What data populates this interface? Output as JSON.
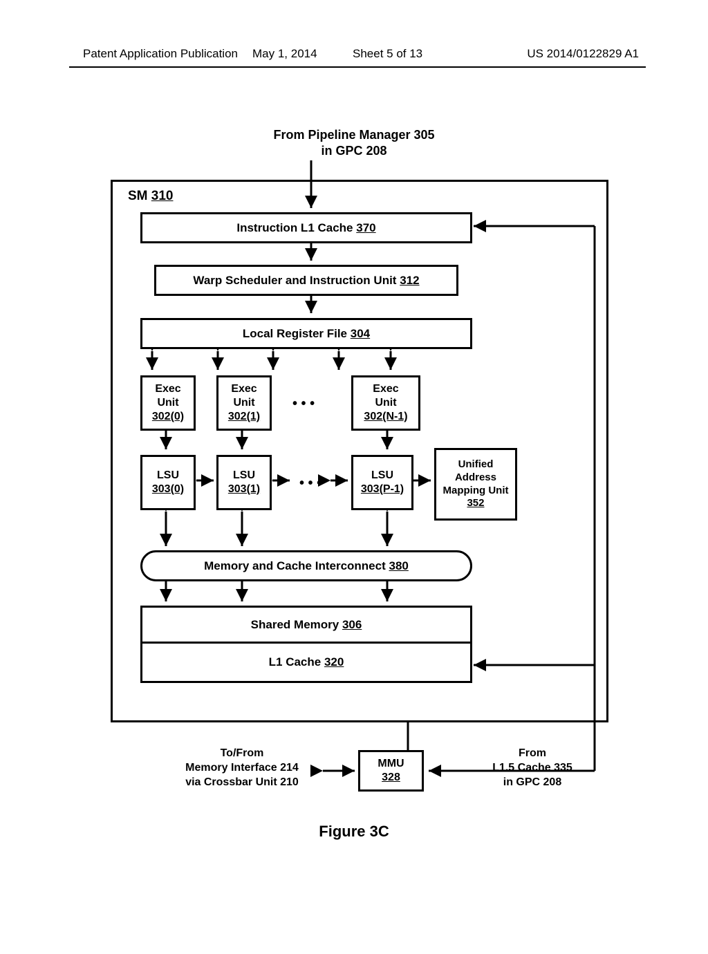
{
  "header": {
    "left": "Patent Application Publication",
    "date": "May 1, 2014",
    "sheet": "Sheet 5 of 13",
    "pubno": "US 2014/0122829 A1"
  },
  "topLabel": {
    "line1": "From Pipeline Manager 305",
    "line2": "in GPC 208"
  },
  "sm": {
    "label": "SM",
    "ref": "310"
  },
  "blocks": {
    "icache": {
      "text": "Instruction L1 Cache",
      "ref": "370"
    },
    "warp": {
      "text": "Warp Scheduler and Instruction Unit",
      "ref": "312"
    },
    "regfile": {
      "text": "Local Register File",
      "ref": "304"
    },
    "exec0": {
      "l1": "Exec",
      "l2": "Unit",
      "ref": "302(0)"
    },
    "exec1": {
      "l1": "Exec",
      "l2": "Unit",
      "ref": "302(1)"
    },
    "execN": {
      "l1": "Exec",
      "l2": "Unit",
      "ref": "302(N-1)"
    },
    "lsu0": {
      "l1": "LSU",
      "ref": "303(0)"
    },
    "lsu1": {
      "l1": "LSU",
      "ref": "303(1)"
    },
    "lsuP": {
      "l1": "LSU",
      "ref": "303(P-1)"
    },
    "uam": {
      "l1": "Unified",
      "l2": "Address",
      "l3": "Mapping Unit",
      "ref": "352"
    },
    "memic": {
      "text": "Memory and Cache Interconnect",
      "ref": "380"
    },
    "shmem": {
      "text": "Shared Memory",
      "ref": "306"
    },
    "l1c": {
      "text": "L1 Cache",
      "ref": "320"
    },
    "mmu": {
      "l1": "MMU",
      "ref": "328"
    }
  },
  "ellipsis": "• • •",
  "bottom": {
    "left": {
      "l1": "To/From",
      "l2": "Memory Interface 214",
      "l3": "via Crossbar Unit 210"
    },
    "right": {
      "l1": "From",
      "l2": "L1.5 Cache 335",
      "l3": "in GPC 208"
    }
  },
  "caption": "Figure 3C"
}
